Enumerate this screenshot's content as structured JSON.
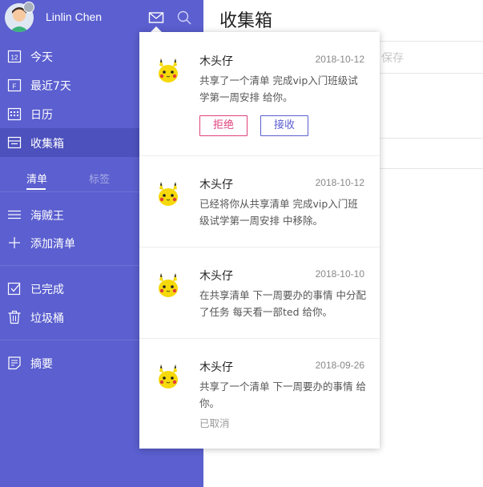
{
  "user": {
    "name": "Linlin Chen"
  },
  "nav": {
    "today": "今天",
    "recent7": "最近7天",
    "calendar": "日历",
    "inbox": "收集箱",
    "tabs": {
      "lists": "清单",
      "tags": "标签"
    },
    "list_haizeiwang": "海贼王",
    "add_list": "添加清单",
    "completed": "已完成",
    "trash": "垃圾桶",
    "summary": "摘要"
  },
  "main": {
    "title": "收集箱",
    "placeholder_fragment": "保存"
  },
  "notifications": [
    {
      "sender": "木头仔",
      "date": "2018-10-12",
      "text": "共享了一个清单 完成vip入门班级试学第一周安排 给你。",
      "reject_label": "拒绝",
      "accept_label": "接收"
    },
    {
      "sender": "木头仔",
      "date": "2018-10-12",
      "text": "已经将你从共享清单 完成vip入门班级试学第一周安排 中移除。"
    },
    {
      "sender": "木头仔",
      "date": "2018-10-10",
      "text": "在共享清单 下一周要办的事情 中分配了任务 每天看一部ted 给你。"
    },
    {
      "sender": "木头仔",
      "date": "2018-09-26",
      "text": "共享了一个清单 下一周要办的事情 给你。",
      "status": "已取消"
    }
  ],
  "colors": {
    "sidebar": "#5b5fcf",
    "sidebar_active": "#4d51bd",
    "reject": "#e0417c",
    "accept": "#5b5fcf"
  },
  "icons": {
    "mail": "mail-icon",
    "search": "search-icon",
    "today": "calendar-12-icon",
    "recent7": "calendar-f-icon",
    "calendar": "calendar-grid-icon",
    "inbox": "inbox-icon",
    "list": "list-icon",
    "add": "plus-icon",
    "completed": "checkbox-icon",
    "trash": "trash-icon",
    "summary": "summary-icon"
  }
}
